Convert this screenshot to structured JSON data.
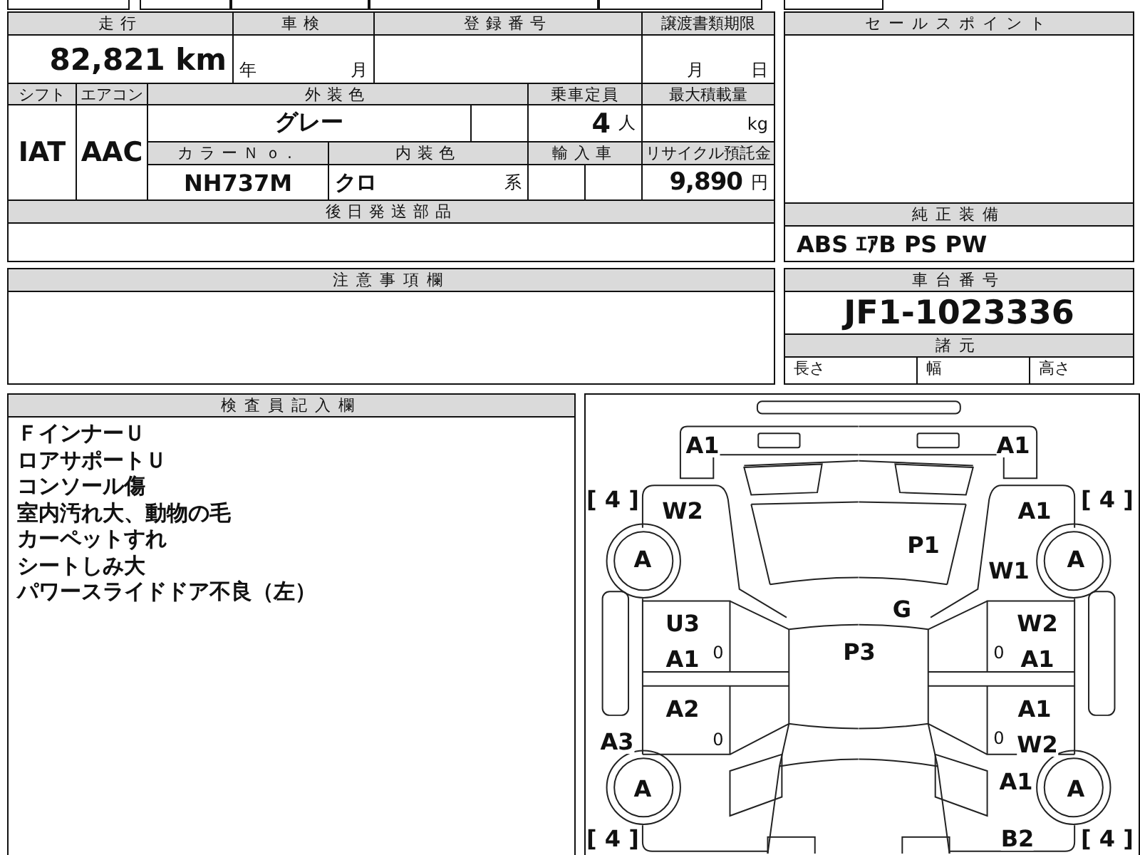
{
  "vehicle_table": {
    "mileage": {
      "label": "走行",
      "value": "82,821 km"
    },
    "inspection": {
      "label": "車検",
      "year_unit": "年",
      "month_unit": "月"
    },
    "registration_number": {
      "label": "登録番号"
    },
    "transfer_deadline": {
      "label": "譲渡書類期限",
      "month_unit": "月",
      "day_unit": "日"
    },
    "shift": {
      "label": "シフト",
      "value": "IAT"
    },
    "air_conditioner": {
      "label": "エアコン",
      "value": "AAC"
    },
    "exterior_color": {
      "label": "外装色",
      "value": "グレー"
    },
    "capacity": {
      "label": "乗車定員",
      "value": "4",
      "unit": "人"
    },
    "max_load": {
      "label": "最大積載量",
      "unit": "kg"
    },
    "color_no": {
      "label": "カラーＮｏ.",
      "value": "NH737M"
    },
    "interior_color": {
      "label": "内装色",
      "value": "クロ",
      "suffix": "系"
    },
    "imported": {
      "label": "輸入車"
    },
    "recycle_fee": {
      "label": "リサイクル預託金",
      "value": "9,890",
      "unit": "円"
    },
    "later_parts": {
      "label": "後日発送部品"
    }
  },
  "sales_point": {
    "label": "セールスポイント"
  },
  "standard_equipment": {
    "label": "純正装備",
    "value": "ABS ｴｱB PS PW"
  },
  "notes": {
    "label": "注意事項欄"
  },
  "chassis": {
    "label": "車台番号",
    "value": "JF1-1023336"
  },
  "specs": {
    "label": "諸元",
    "items": [
      "長さ",
      "幅",
      "高さ"
    ]
  },
  "inspector_notes": {
    "label": "検査員記入欄",
    "lines": [
      "ＦインナーＵ",
      "ロアサポートＵ",
      "コンソール傷",
      "室内汚れ大、動物の毛",
      "カーペットすれ",
      "シートしみ大",
      "パワースライドドア不良（左）"
    ]
  },
  "damage_diagram": {
    "marks": [
      {
        "text": "A1",
        "kind": "code"
      },
      {
        "text": "A1",
        "kind": "code"
      },
      {
        "text": "[ 4 ]",
        "kind": "code"
      },
      {
        "text": "W2",
        "kind": "code"
      },
      {
        "text": "A1",
        "kind": "code"
      },
      {
        "text": "[ 4 ]",
        "kind": "code"
      },
      {
        "text": "P1",
        "kind": "code"
      },
      {
        "text": "A",
        "kind": "code"
      },
      {
        "text": "W1",
        "kind": "code"
      },
      {
        "text": "A",
        "kind": "code"
      },
      {
        "text": "G",
        "kind": "code"
      },
      {
        "text": "U3",
        "kind": "code"
      },
      {
        "text": "W2",
        "kind": "code"
      },
      {
        "text": "A1",
        "kind": "code"
      },
      {
        "text": "0",
        "kind": "small"
      },
      {
        "text": "P3",
        "kind": "code"
      },
      {
        "text": "0",
        "kind": "small"
      },
      {
        "text": "A1",
        "kind": "code"
      },
      {
        "text": "A2",
        "kind": "code"
      },
      {
        "text": "A1",
        "kind": "code"
      },
      {
        "text": "A3",
        "kind": "code"
      },
      {
        "text": "0",
        "kind": "small"
      },
      {
        "text": "0",
        "kind": "small"
      },
      {
        "text": "W2",
        "kind": "code"
      },
      {
        "text": "A",
        "kind": "code"
      },
      {
        "text": "A1",
        "kind": "code"
      },
      {
        "text": "A",
        "kind": "code"
      },
      {
        "text": "[ 4 ]",
        "kind": "code"
      },
      {
        "text": "B2",
        "kind": "code"
      },
      {
        "text": "[ 4 ]",
        "kind": "code"
      }
    ]
  }
}
